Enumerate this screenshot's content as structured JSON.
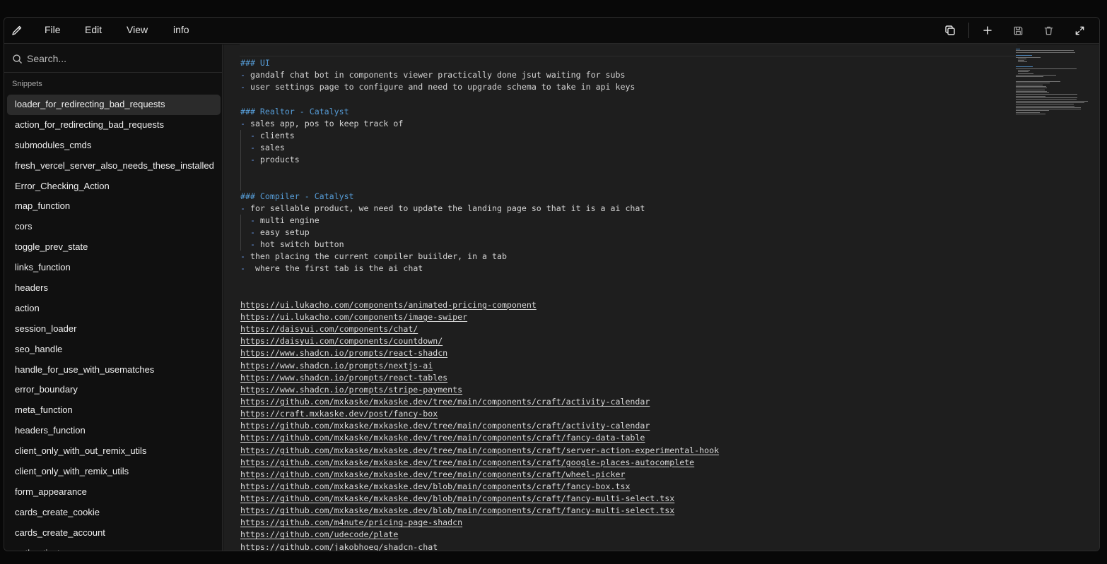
{
  "menubar": {
    "items": [
      "File",
      "Edit",
      "View",
      "info"
    ]
  },
  "toolbar": {
    "icons": [
      "copy-icon",
      "plus-icon",
      "save-icon",
      "trash-icon",
      "expand-icon"
    ]
  },
  "sidebar": {
    "search_placeholder": "Search...",
    "section_label": "Snippets",
    "items": [
      "loader_for_redirecting_bad_requests",
      "action_for_redirecting_bad_requests",
      "submodules_cmds",
      "fresh_vercel_server_also_needs_these_installed",
      "Error_Checking_Action",
      "map_function",
      "cors",
      "toggle_prev_state",
      "links_function",
      "headers",
      "action",
      "session_loader",
      "seo_handle",
      "handle_for_use_with_usematches",
      "error_boundary",
      "meta_function",
      "headers_function",
      "client_only_with_out_remix_utils",
      "client_only_with_remix_utils",
      "form_appearance",
      "cards_create_cookie",
      "cards_create_account",
      "authenticator"
    ],
    "active_index": 0
  },
  "editor": {
    "lines": [
      {
        "kind": "heading",
        "text": "### UI"
      },
      {
        "kind": "bullet",
        "marker": "- ",
        "text": "gandalf chat bot in components viewer practically done jsut waiting for subs"
      },
      {
        "kind": "bullet",
        "marker": "- ",
        "text": "user settings page to configure and need to upgrade schema to take in api keys"
      },
      {
        "kind": "blank",
        "text": ""
      },
      {
        "kind": "heading",
        "text": "### Realtor - Catalyst"
      },
      {
        "kind": "bullet",
        "marker": "- ",
        "text": "sales app, pos to keep track of"
      },
      {
        "kind": "sub",
        "marker": "  - ",
        "text": "clients"
      },
      {
        "kind": "sub",
        "marker": "  - ",
        "text": "sales"
      },
      {
        "kind": "sub",
        "marker": "  - ",
        "text": "products"
      },
      {
        "kind": "guide",
        "text": ""
      },
      {
        "kind": "guide",
        "text": ""
      },
      {
        "kind": "heading",
        "text": "### Compiler - Catalyst"
      },
      {
        "kind": "bullet",
        "marker": "- ",
        "text": "for sellable product, we need to update the landing page so that it is a ai chat"
      },
      {
        "kind": "sub",
        "marker": "  - ",
        "text": "multi engine"
      },
      {
        "kind": "sub",
        "marker": "  - ",
        "text": "easy setup"
      },
      {
        "kind": "sub",
        "marker": "  - ",
        "text": "hot switch button"
      },
      {
        "kind": "bullet",
        "marker": "- ",
        "text": "then placing the current compiler buiilder, in a tab"
      },
      {
        "kind": "bullet",
        "marker": "-  ",
        "text": "where the first tab is the ai chat"
      },
      {
        "kind": "blank",
        "text": ""
      },
      {
        "kind": "blank",
        "text": ""
      },
      {
        "kind": "link",
        "text": "https://ui.lukacho.com/components/animated-pricing-component"
      },
      {
        "kind": "link",
        "text": "https://ui.lukacho.com/components/image-swiper"
      },
      {
        "kind": "link",
        "text": "https://daisyui.com/components/chat/"
      },
      {
        "kind": "link",
        "text": "https://daisyui.com/components/countdown/"
      },
      {
        "kind": "link",
        "text": "https://www.shadcn.io/prompts/react-shadcn"
      },
      {
        "kind": "link",
        "text": "https://www.shadcn.io/prompts/nextjs-ai"
      },
      {
        "kind": "link",
        "text": "https://www.shadcn.io/prompts/react-tables"
      },
      {
        "kind": "link",
        "text": "https://www.shadcn.io/prompts/stripe-payments"
      },
      {
        "kind": "link",
        "text": "https://github.com/mxkaske/mxkaske.dev/tree/main/components/craft/activity-calendar"
      },
      {
        "kind": "link",
        "text": "https://craft.mxkaske.dev/post/fancy-box"
      },
      {
        "kind": "link",
        "text": "https://github.com/mxkaske/mxkaske.dev/tree/main/components/craft/activity-calendar"
      },
      {
        "kind": "link",
        "text": "https://github.com/mxkaske/mxkaske.dev/tree/main/components/craft/fancy-data-table"
      },
      {
        "kind": "link",
        "text": "https://github.com/mxkaske/mxkaske.dev/tree/main/components/craft/server-action-experimental-hook"
      },
      {
        "kind": "link",
        "text": "https://github.com/mxkaske/mxkaske.dev/tree/main/components/craft/google-places-autocomplete"
      },
      {
        "kind": "link",
        "text": "https://github.com/mxkaske/mxkaske.dev/tree/main/components/craft/wheel-picker"
      },
      {
        "kind": "link",
        "text": "https://github.com/mxkaske/mxkaske.dev/blob/main/components/craft/fancy-box.tsx"
      },
      {
        "kind": "link",
        "text": "https://github.com/mxkaske/mxkaske.dev/blob/main/components/craft/fancy-multi-select.tsx"
      },
      {
        "kind": "link",
        "text": "https://github.com/mxkaske/mxkaske.dev/blob/main/components/craft/fancy-multi-select.tsx"
      },
      {
        "kind": "link",
        "text": "https://github.com/m4nute/pricing-page-shadcn"
      },
      {
        "kind": "link",
        "text": "https://github.com/udecode/plate"
      },
      {
        "kind": "link",
        "text": "https://github.com/jakobhoeg/shadcn-chat"
      }
    ]
  },
  "colors": {
    "heading": "#569cd6",
    "editor_bg": "#1e1e1e",
    "sidebar_bg": "#101010",
    "active_item_bg": "#2b2b2b"
  }
}
